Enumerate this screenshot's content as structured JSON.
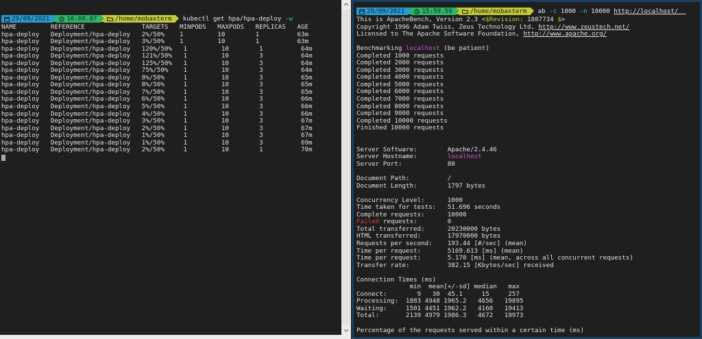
{
  "palette": {
    "terminal_bg": "#1f1f1f",
    "prompt_date_bg": "#2a9ad2",
    "prompt_time_bg": "#2eb565",
    "prompt_path_bg": "#c6ca35",
    "right_window_border": "#1a3f63",
    "flag_cyan": "#36c2cd",
    "hostname_magenta": "#cf56cf",
    "revision_yellow": "#c9c932",
    "failed_red": "#c8473b"
  },
  "left": {
    "prompt": {
      "date": "29/09/2021",
      "time": "16:00.07",
      "path": "/home/mobaxterm",
      "cmd_main": "kubectl get hpa/hpa-deploy ",
      "cmd_flag": "-w"
    },
    "table_lines": [
      "NAME         REFERENCE               TARGETS   MINPODS   MAXPODS   REPLICAS   AGE",
      "hpa-deploy   Deployment/hpa-deploy   2%/50%    1         10        1          63m",
      "hpa-deploy   Deployment/hpa-deploy   3%/50%    1         10        1          63m",
      "hpa-deploy   Deployment/hpa-deploy   120%/50%   1         10        1          64m",
      "hpa-deploy   Deployment/hpa-deploy   121%/50%   1         10        3          64m",
      "hpa-deploy   Deployment/hpa-deploy   125%/50%   1         10        3          64m",
      "hpa-deploy   Deployment/hpa-deploy   75%/50%    1         10        3          64m",
      "hpa-deploy   Deployment/hpa-deploy   8%/50%     1         10        3          65m",
      "hpa-deploy   Deployment/hpa-deploy   8%/50%     1         10        3          65m",
      "hpa-deploy   Deployment/hpa-deploy   7%/50%     1         10        3          65m",
      "hpa-deploy   Deployment/hpa-deploy   6%/50%     1         10        3          66m",
      "hpa-deploy   Deployment/hpa-deploy   5%/50%     1         10        3          66m",
      "hpa-deploy   Deployment/hpa-deploy   4%/50%     1         10        3          66m",
      "hpa-deploy   Deployment/hpa-deploy   3%/50%     1         10        3          67m",
      "hpa-deploy   Deployment/hpa-deploy   2%/50%     1         10        3          67m",
      "hpa-deploy   Deployment/hpa-deploy   1%/50%     1         10        3          67m",
      "hpa-deploy   Deployment/hpa-deploy   1%/50%     1         10        3          69m",
      "hpa-deploy   Deployment/hpa-deploy   2%/50%     1         10        1          70m"
    ]
  },
  "right": {
    "prompt": {
      "date": "29/09/2021",
      "time": "15:59.59",
      "path": "/home/mobaxterm",
      "cmd_ab": "ab ",
      "flag_c": "-c",
      "val_c": " 1000 ",
      "flag_n": "-n",
      "val_n": " 10000 ",
      "url": "http://localhost/  "
    },
    "intro": {
      "version_pre": "This is ApacheBench, Version 2.3 <",
      "revision_label": "$Revision:",
      "revision_value": " 1807734 ",
      "dollar": "$",
      "gt": ">",
      "copyright_pre": "Copyright 1996 Adam Twiss, Zeus Technology Ltd, ",
      "copyright_url": "http://www.zeustech.net/",
      "licensed_pre": "Licensed to The Apache Software Foundation, ",
      "licensed_url": "http://www.apache.org/"
    },
    "bench": {
      "pre": "Benchmarking ",
      "host": "localhost",
      "post": " (be patient)"
    },
    "completed_lines": [
      "Completed 1000 requests",
      "Completed 2000 requests",
      "Completed 3000 requests",
      "Completed 4000 requests",
      "Completed 5000 requests",
      "Completed 6000 requests",
      "Completed 7000 requests",
      "Completed 8000 requests",
      "Completed 9000 requests",
      "Completed 10000 requests",
      "Finished 10000 requests"
    ],
    "server": {
      "software": "Server Software:        Apache/2.4.46",
      "hostname_label": "Server Hostname:        ",
      "hostname": "localhost",
      "port": "Server Port:            80"
    },
    "document_lines": [
      "Document Path:          /",
      "Document Length:        1797 bytes"
    ],
    "stats_before_failed": [
      "Concurrency Level:      1000",
      "Time taken for tests:   51.696 seconds",
      "Complete requests:      10000"
    ],
    "failed": {
      "label": "Failed",
      "rest": " requests:        0"
    },
    "stats_after_failed": [
      "Total transferred:      20230000 bytes",
      "HTML transferred:       17970000 bytes",
      "Requests per second:    193.44 [#/sec] (mean)",
      "Time per request:       5169.613 [ms] (mean)",
      "Time per request:       5.170 [ms] (mean, across all concurrent requests)",
      "Transfer rate:          382.15 [Kbytes/sec] received"
    ],
    "connection_lines": [
      "Connection Times (ms)",
      "              min  mean[+/-sd] median   max",
      "Connect:        9   30  45.1     15     257",
      "Processing:  1883 4948 1965.2   4656   19895",
      "Waiting:     1501 4451 1962.2   4160   19413",
      "Total:       2139 4979 1986.3   4672   19973"
    ],
    "percentage_header": "Percentage of the requests served within a certain time (ms)"
  }
}
